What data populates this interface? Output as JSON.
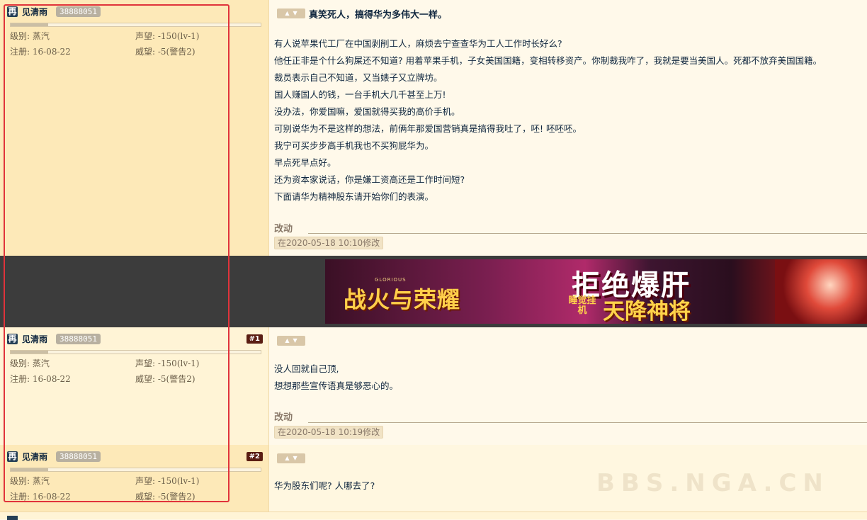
{
  "user": {
    "avatar_char": "再",
    "name": "见清雨",
    "uid": "38888051",
    "level_label": "级别: 蒸汽",
    "prestige_label": "声望: -150(lv-1)",
    "register_label": "注册: 16-08-22",
    "reputation_label": "威望: -5(警告2)"
  },
  "post0": {
    "title": "真笑死人，搞得华为多伟大一样。",
    "lines": [
      "有人说苹果代工厂在中国剥削工人，麻烦去宁查查华为工人工作时长好么?",
      "他任正非是个什么狗屎还不知道? 用着苹果手机，子女美国国籍，变相转移资产。你制裁我咋了，我就是要当美国人。死都不放弃美国国籍。",
      "裁员表示自己不知道，又当婊子又立牌坊。",
      "国人赚国人的钱，一台手机大几千甚至上万!",
      "没办法，你爱国嘛，爱国就得买我的高价手机。",
      "可别说华为不是这样的想法，前俩年那爱国营销真是搞得我吐了，呸! 呸呸呸。",
      "我宁可买步步高手机我也不买狗屁华为。",
      "早点死早点好。",
      "还为资本家说话，你是嫌工资高还是工作时间短?",
      "下面请华为精神股东请开始你们的表演。"
    ],
    "edit_title": "改动",
    "edit_time": "在2020-05-18 10:10修改"
  },
  "post1": {
    "floor": "#1",
    "lines": [
      "没人回就自己顶,",
      "想想那些宣传语真是够恶心的。"
    ],
    "edit_title": "改动",
    "edit_time": "在2020-05-18 10:19修改"
  },
  "post2": {
    "floor": "#2",
    "lines": [
      "华为股东们呢? 人哪去了?"
    ]
  },
  "ad": {
    "logo_small": "GLORIOUS",
    "logo": "战火与荣耀",
    "headline": "拒绝爆肝",
    "tag": "睡觉挂机",
    "subline": "天降神将"
  },
  "watermark": "BBS.NGA.CN",
  "colors": {
    "highlight": "#e0333b",
    "floor_badge": "#5a1d12",
    "sidebar_bg": "#fde9b8"
  }
}
